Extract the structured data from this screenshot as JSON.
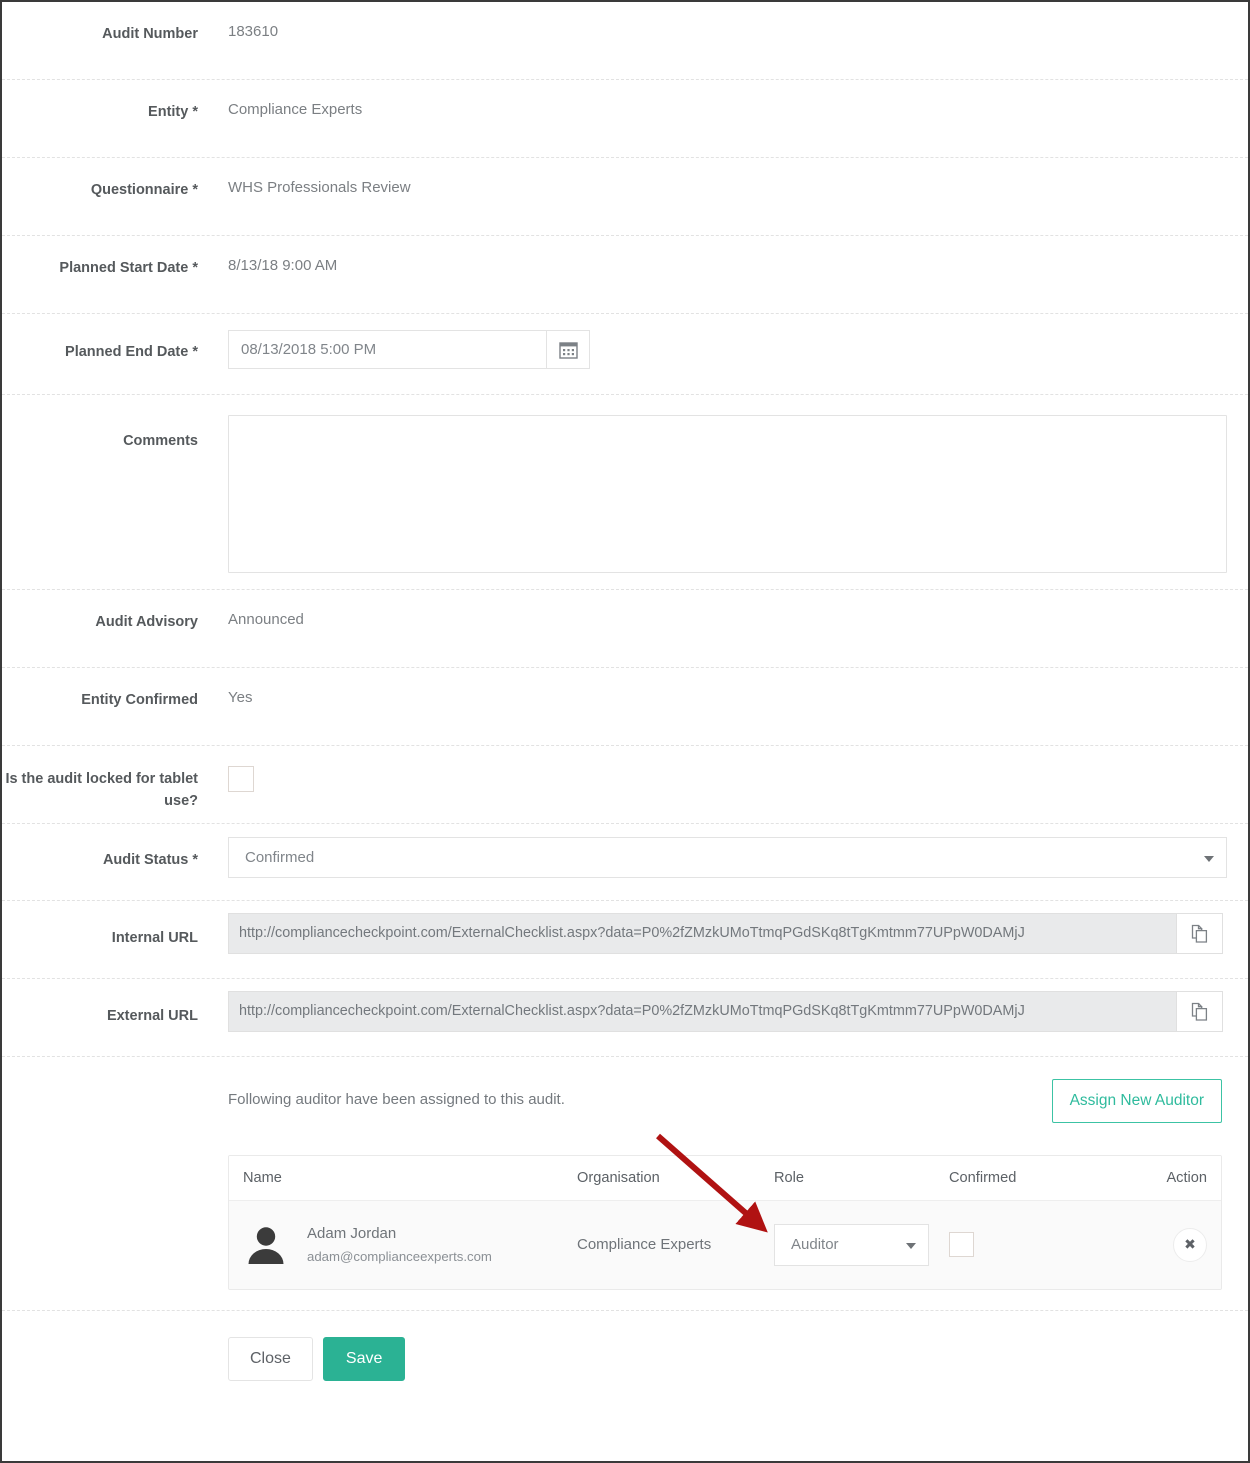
{
  "form": {
    "rows": [
      {
        "label": "Audit Number",
        "value": "183610"
      },
      {
        "label": "Entity *",
        "value": "Compliance Experts"
      },
      {
        "label": "Questionnaire *",
        "value": "WHS Professionals Review"
      },
      {
        "label": "Planned Start Date *",
        "value": "8/13/18 9:00 AM"
      },
      {
        "label": "Planned End Date *",
        "value": "08/13/2018 5:00 PM"
      },
      {
        "label": "Comments",
        "value": ""
      },
      {
        "label": "Audit Advisory",
        "value": "Announced"
      },
      {
        "label": "Entity Confirmed",
        "value": "Yes"
      },
      {
        "label": "Is the audit locked for tablet use?",
        "value": ""
      },
      {
        "label": "Audit Status *",
        "value": "Confirmed"
      },
      {
        "label": "Internal URL",
        "value": "http://compliancecheckpoint.com/ExternalChecklist.aspx?data=P0%2fZMzkUMoTtmqPGdSKq8tTgKmtmm77UPpW0DAMjJ"
      },
      {
        "label": "External URL",
        "value": "http://compliancecheckpoint.com/ExternalChecklist.aspx?data=P0%2fZMzkUMoTtmqPGdSKq8tTgKmtmm77UPpW0DAMjJ"
      }
    ],
    "comments_placeholder": "",
    "audit_status_options": [
      "Confirmed"
    ],
    "lock_checkbox_checked": false
  },
  "auditors": {
    "note": "Following auditor have been assigned to this audit.",
    "assign_button": "Assign New Auditor",
    "columns": [
      "Name",
      "Organisation",
      "Role",
      "Confirmed",
      "Action"
    ],
    "rows": [
      {
        "name": "Adam Jordan",
        "email": "adam@complianceexperts.com",
        "organisation": "Compliance Experts",
        "role": "Auditor",
        "role_options": [
          "Auditor"
        ],
        "confirmed": false,
        "action_icon": "close-icon"
      }
    ]
  },
  "footer": {
    "close_label": "Close",
    "save_label": "Save"
  },
  "icons": {
    "calendar": "calendar-icon",
    "copy": "copy-icon",
    "avatar": "avatar-icon",
    "dropdown": "chevron-down-icon",
    "remove": "close-icon"
  },
  "colors": {
    "accent_green": "#2bb294",
    "assign_border": "#3cc3a4",
    "label_text": "#55595c",
    "value_text": "#7b7f83",
    "annotation_arrow": "#b01212",
    "url_field_bg": "#e9eaeb"
  },
  "annotation": {
    "arrow_color": "#b01212",
    "points_to": "role-select-column"
  }
}
